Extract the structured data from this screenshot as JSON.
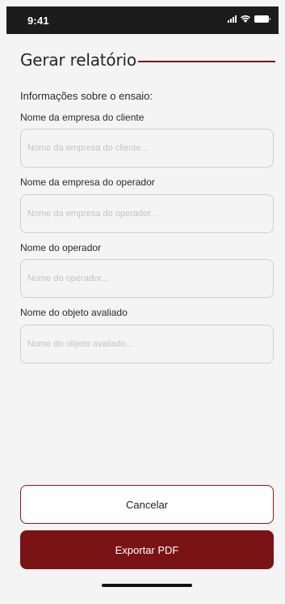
{
  "status_bar": {
    "time": "9:41",
    "icons": [
      "cellular-signal-icon",
      "wifi-icon",
      "battery-icon"
    ]
  },
  "header": {
    "title": "Gerar relatório",
    "accent_color": "#7b1414"
  },
  "form": {
    "section_label": "Informações sobre o ensaio:",
    "fields": [
      {
        "label": "Nome da empresa do cliente",
        "placeholder": "Nome da empresa do cliente...",
        "value": ""
      },
      {
        "label": "Nome da empresa do operador",
        "placeholder": "Nome da empresa do operador...",
        "value": ""
      },
      {
        "label": "Nome do operador",
        "placeholder": "Nome do operador...",
        "value": ""
      },
      {
        "label": "Nome do objeto avaliado",
        "placeholder": "Nome do objeto avaliado...",
        "value": ""
      }
    ]
  },
  "actions": {
    "cancel_label": "Cancelar",
    "export_label": "Exportar PDF",
    "primary_color": "#7a1313"
  }
}
